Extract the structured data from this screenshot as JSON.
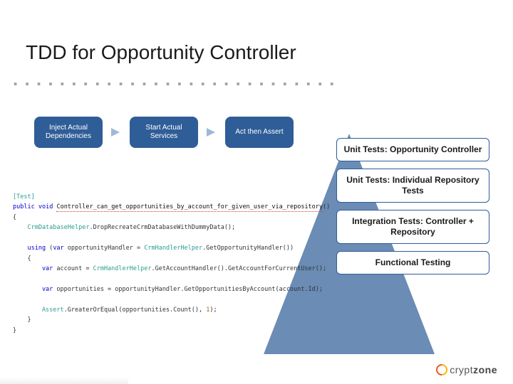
{
  "title": "TDD for Opportunity Controller",
  "dots": ". . . . . . . . . . . . . . . . . . . . . . . . . . . . . . . . . . . . .",
  "flow": {
    "steps": [
      "Inject Actual Dependencies",
      "Start Actual Services",
      "Act then Assert"
    ]
  },
  "pyramid": {
    "levels": [
      "Unit Tests: Opportunity Controller",
      "Unit Tests: Individual Repository Tests",
      "Integration Tests: Controller + Repository",
      "Functional Testing"
    ]
  },
  "code": {
    "attr": "[Test]",
    "kw_public": "public",
    "kw_void": "void",
    "method": "Controller_can_get_opportunities_by_account_for_given_user_via_repository",
    "pl": "()",
    "ob": "{",
    "cb": "}",
    "l1a": "    CrmDatabaseHelper",
    "l1b": ".DropRecreateCrmDatabaseWithDummyData();",
    "kw_using": "    using",
    "kw_var1": "var",
    "l2a": " opportunityHandler = ",
    "l2b": "CrmHandlerHelper",
    "l2c": ".GetOpportunityHandler())",
    "ob_indent": "    {",
    "kw_var2": "        var",
    "l3a": " account = ",
    "l3b": "CrmHandlerHelper",
    "l3c": ".GetAccountHandler().GetAccountForCurrentUser();",
    "kw_var3": "        var",
    "l4a": " opportunities = opportunityHandler.GetOpportunitiesByAccount(account.Id);",
    "l5a": "        Assert",
    "l5b": ".GreaterOrEqual(opportunities.Count(), ",
    "l5n": "1",
    "l5c": ");",
    "cb_indent": "    }"
  },
  "logo": {
    "part1": "crypt",
    "part2": "zone"
  }
}
